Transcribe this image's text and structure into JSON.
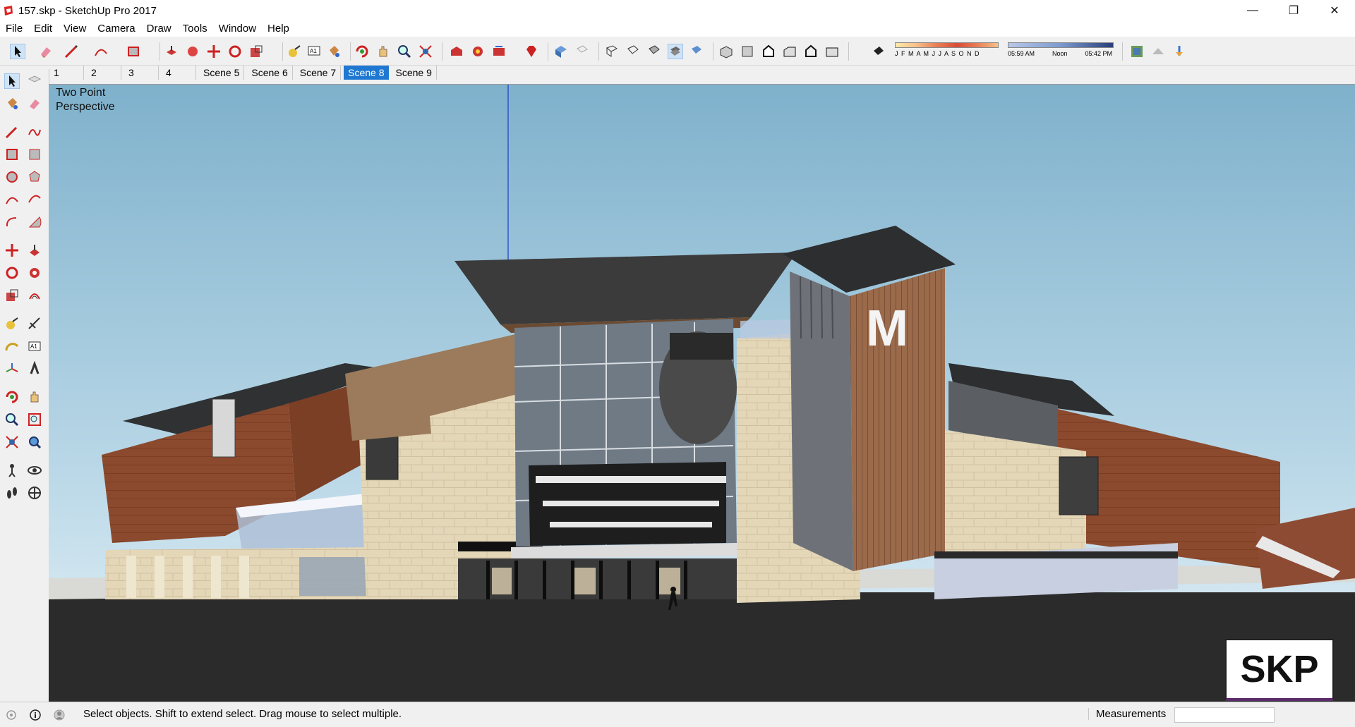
{
  "window": {
    "title": "157.skp - SketchUp Pro 2017",
    "minimize": "—",
    "maximize": "❐",
    "close": "✕"
  },
  "menu": [
    "File",
    "Edit",
    "View",
    "Camera",
    "Draw",
    "Tools",
    "Window",
    "Help"
  ],
  "shadow": {
    "months": "J F M A M J J A S O N D",
    "time_start": "05:59 AM",
    "time_mid": "Noon",
    "time_end": "05:42 PM"
  },
  "scenes": [
    "1",
    "2",
    "3",
    "4",
    "Scene 5",
    "Scene 6",
    "Scene 7",
    "Scene 8",
    "Scene 9"
  ],
  "active_scene": "Scene 8",
  "viewport": {
    "label_line1": "Two Point",
    "label_line2": "Perspective",
    "badge": "SKP"
  },
  "status": {
    "message": "Select objects. Shift to extend select. Drag mouse to select multiple.",
    "measurements_label": "Measurements",
    "measurements_value": ""
  },
  "colors": {
    "sky_top": "#7fb1cc",
    "sky_bottom": "#dfeef6",
    "ground": "#2b2b2b",
    "accent": "#1e78d2"
  }
}
